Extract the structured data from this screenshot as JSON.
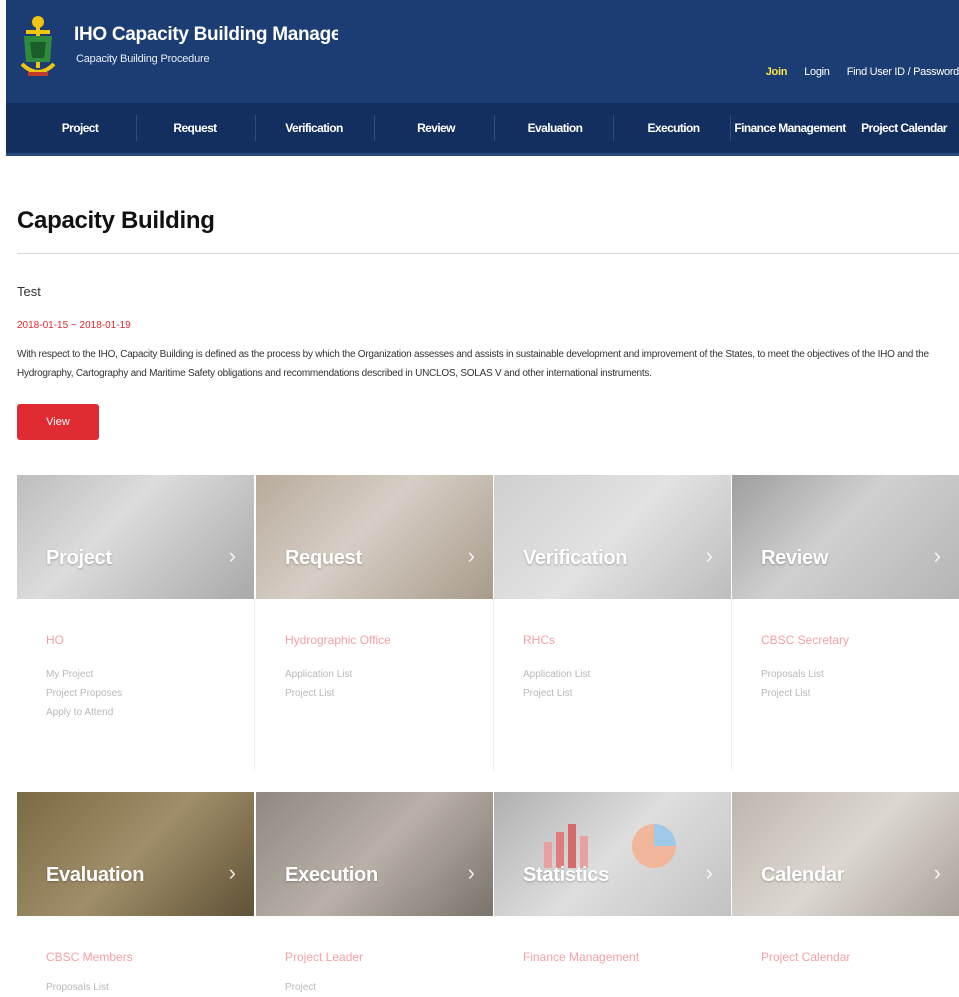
{
  "header": {
    "title": "IHO Capacity Building Management",
    "subtitle": "Capacity Building Procedure",
    "links": {
      "join": "Join",
      "login": "Login",
      "find": "Find User ID / Password"
    }
  },
  "nav": [
    "Project",
    "Request",
    "Verification",
    "Review",
    "Evaluation",
    "Execution",
    "Finance Management",
    "Project Calendar"
  ],
  "page": {
    "title": "Capacity Building",
    "post_title": "Test",
    "post_date": "2018-01-15 ~ 2018-01-19",
    "post_desc": "With respect to the IHO, Capacity Building is defined as the process by which the Organization assesses and assists in sustainable development and improvement of the States, to meet the objectives of the IHO and the Hydrography, Cartography and Maritime Safety obligations and recommendations described in UNCLOS, SOLAS V and other international instruments.",
    "view_label": "View"
  },
  "cards": [
    {
      "label": "Project",
      "role": "HO",
      "links": [
        "My Project",
        "Project Proposes",
        "Apply to Attend"
      ],
      "color": "#cfcfcf"
    },
    {
      "label": "Request",
      "role": "Hydrographic Office",
      "links": [
        "Application List",
        "Project List"
      ],
      "color": "#c8bfb5"
    },
    {
      "label": "Verification",
      "role": "RHCs",
      "links": [
        "Application List",
        "Project List"
      ],
      "color": "#d6d6d6"
    },
    {
      "label": "Review",
      "role": "CBSC Secretary",
      "links": [
        "Proposals List",
        "Project List"
      ],
      "color": "#c3c3c3"
    },
    {
      "label": "Evaluation",
      "role": "CBSC Members",
      "links": [
        "Proposals List"
      ],
      "color": "#9a8a66"
    },
    {
      "label": "Execution",
      "role": "Project Leader",
      "links": [
        "Project"
      ],
      "color": "#a8a29a"
    },
    {
      "label": "Statistics",
      "role": "Finance Management",
      "links": [],
      "color": "#cacaca"
    },
    {
      "label": "Calendar",
      "role": "Project Calendar",
      "links": [],
      "color": "#c4bfba"
    }
  ],
  "icons": {
    "chevron": "chevron-right-icon",
    "logo": "iho-emblem-icon"
  },
  "colors": {
    "header": "#1c3d73",
    "nav": "#132f60",
    "accent": "#e12b33",
    "join": "#ffe44c"
  }
}
